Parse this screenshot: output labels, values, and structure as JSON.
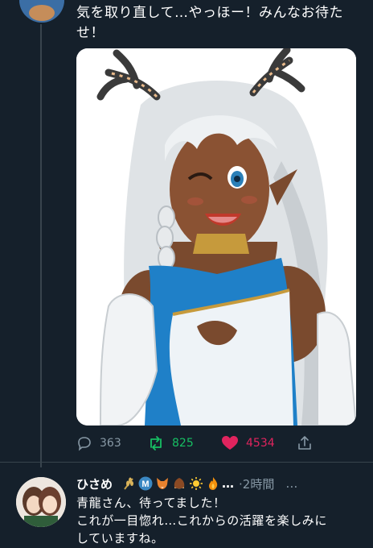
{
  "tweet": {
    "text": "気を取り直して…やっほー！みんなお待たせ！",
    "stats": {
      "replies": "363",
      "retweets": "825",
      "likes": "4534"
    }
  },
  "reply": {
    "display_name": "ひさめ",
    "name_suffix": "…",
    "time": "·2時間",
    "more_label": "…",
    "text_lines": [
      "青龍さん、待ってました！",
      "これが一目惚れ…これからの活躍を楽しみに",
      "していますね。"
    ],
    "emoji_icons": [
      "wheat-emoji",
      "m-circle-emoji",
      "fox-emoji",
      "chestnut-emoji",
      "sun-emoji",
      "fire-emoji"
    ]
  },
  "colors": {
    "background": "#15202b",
    "secondary_text": "#8899a6",
    "retweet_green": "#17bf63",
    "like_red": "#e0245e"
  }
}
